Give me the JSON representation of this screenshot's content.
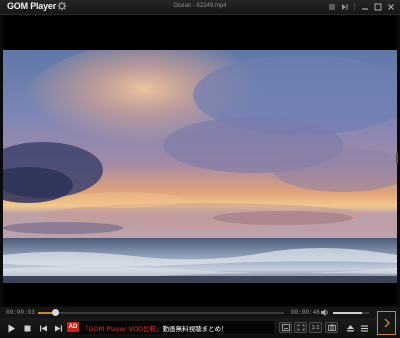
{
  "titlebar": {
    "logo": "GOM Player",
    "file_title": "Ocean - 62249.mp4"
  },
  "player": {
    "time_current": "00:00:03",
    "time_total": "00:00:46",
    "progress_fraction": 0.07,
    "volume_fraction": 0.8
  },
  "ad": {
    "badge": "AD",
    "text_highlight": "「GOM Player VOD比較」",
    "text_rest": "動画無料視聴まとめ！"
  },
  "controls": {
    "speed_label": "1:1"
  },
  "colors": {
    "seek_fill": "#c98a1a",
    "ad_red": "#d21c1c",
    "accent_orange": "#d0892a"
  }
}
